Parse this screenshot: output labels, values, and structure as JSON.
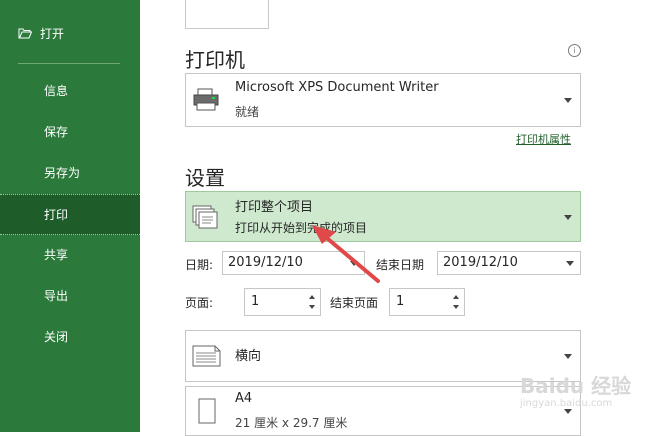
{
  "sidebar": {
    "open_label": "打开",
    "items": [
      {
        "label": "信息"
      },
      {
        "label": "保存"
      },
      {
        "label": "另存为"
      },
      {
        "label": "打印"
      },
      {
        "label": "共享"
      },
      {
        "label": "导出"
      },
      {
        "label": "关闭"
      }
    ],
    "active": "打印"
  },
  "printer": {
    "section_title": "打印机",
    "name": "Microsoft XPS Document Writer",
    "status": "就绪",
    "properties_link": "打印机属性"
  },
  "settings": {
    "section_title": "设置",
    "print_scope": {
      "title": "打印整个项目",
      "subtitle": "打印从开始到完成的项目"
    },
    "date_label": "日期:",
    "start_date": "2019/12/10",
    "end_date_label": "结束日期",
    "end_date": "2019/12/10",
    "page_label": "页面:",
    "page_start": "1",
    "end_page_label": "结束页面",
    "page_end": "1",
    "orientation": "横向",
    "paper": {
      "name": "A4",
      "size": "21 厘米 x 29.7 厘米"
    }
  },
  "watermark": {
    "main": "Baidu 经验",
    "sub": "jingyan.baidu.com"
  },
  "colors": {
    "sidebar": "#2b7a3b",
    "active_item": "#1e5c2a",
    "settings_highlight": "#cfe9cf",
    "arrow": "#e0484a"
  }
}
